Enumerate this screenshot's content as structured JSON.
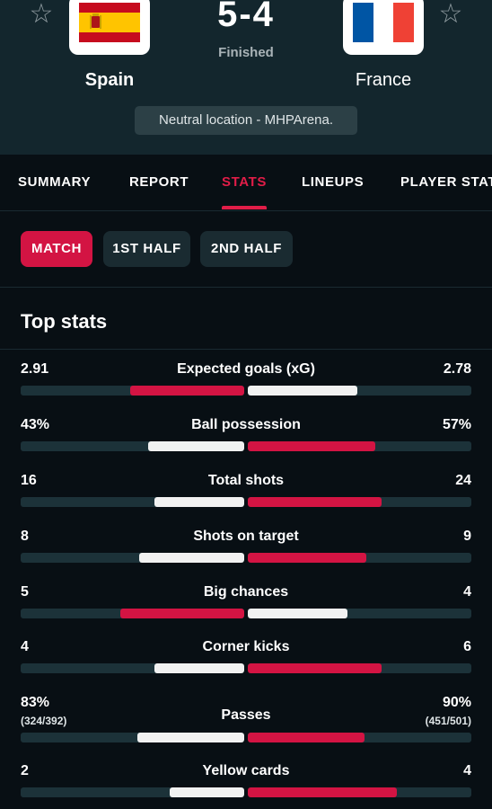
{
  "match": {
    "home_team": "Spain",
    "away_team": "France",
    "score": "5-4",
    "status": "Finished",
    "venue": "Neutral location - MHPArena."
  },
  "icons": {
    "favorite": "star-outline-icon",
    "home_flag": "spain-flag-icon",
    "away_flag": "france-flag-icon"
  },
  "tabs": [
    {
      "label": "SUMMARY",
      "active": false
    },
    {
      "label": "REPORT",
      "active": false
    },
    {
      "label": "STATS",
      "active": true
    },
    {
      "label": "LINEUPS",
      "active": false
    },
    {
      "label": "PLAYER STATS",
      "active": false
    }
  ],
  "periods": [
    {
      "label": "MATCH",
      "active": true
    },
    {
      "label": "1ST HALF",
      "active": false
    },
    {
      "label": "2ND HALF",
      "active": false
    }
  ],
  "section_title": "Top stats",
  "colors": {
    "accent": "#e11d48",
    "bar_highlight": "#d31443",
    "bar_other": "#f1f1f1",
    "header_bg": "#13262d",
    "page_bg": "#080f14"
  },
  "stats": [
    {
      "label": "Expected goals (xG)",
      "home": "2.91",
      "away": "2.78",
      "home_num": 2.91,
      "away_num": 2.78,
      "winner": "home"
    },
    {
      "label": "Ball possession",
      "home": "43%",
      "away": "57%",
      "home_num": 43,
      "away_num": 57,
      "winner": "away"
    },
    {
      "label": "Total shots",
      "home": "16",
      "away": "24",
      "home_num": 16,
      "away_num": 24,
      "winner": "away"
    },
    {
      "label": "Shots on target",
      "home": "8",
      "away": "9",
      "home_num": 8,
      "away_num": 9,
      "winner": "away"
    },
    {
      "label": "Big chances",
      "home": "5",
      "away": "4",
      "home_num": 5,
      "away_num": 4,
      "winner": "home"
    },
    {
      "label": "Corner kicks",
      "home": "4",
      "away": "6",
      "home_num": 4,
      "away_num": 6,
      "winner": "away"
    },
    {
      "label": "Passes",
      "home": "83%",
      "away": "90%",
      "home_sub": "(324/392)",
      "away_sub": "(451/501)",
      "home_num": 83,
      "away_num": 90,
      "winner": "away"
    },
    {
      "label": "Yellow cards",
      "home": "2",
      "away": "4",
      "home_num": 2,
      "away_num": 4,
      "winner": "away"
    }
  ]
}
